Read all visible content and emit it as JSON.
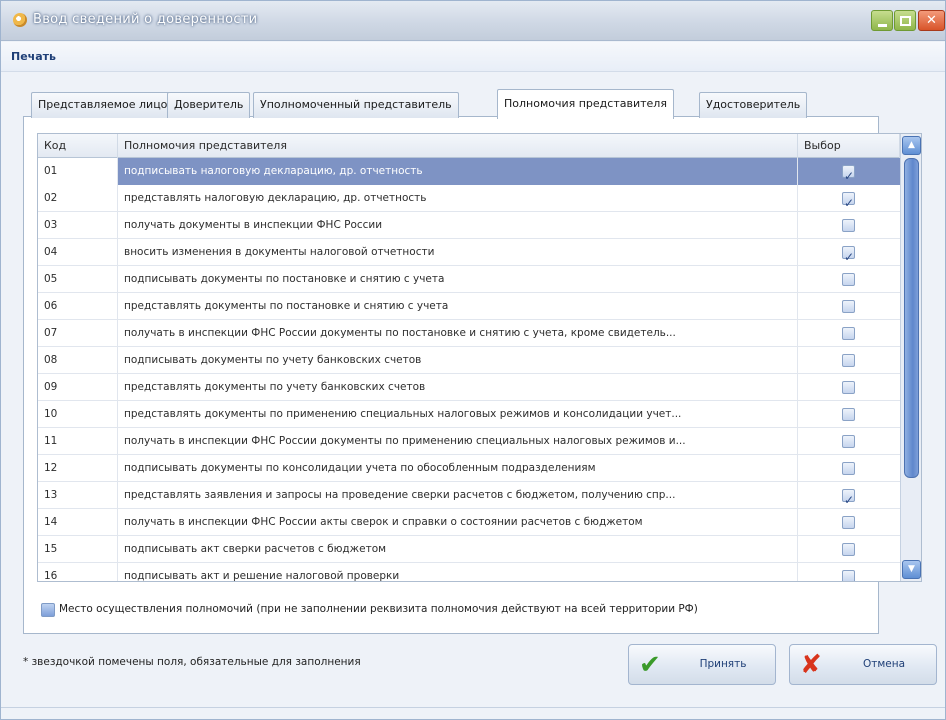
{
  "window": {
    "title": "Ввод сведений о доверенности",
    "controls": {
      "minimize_icon": "minimize-icon",
      "maximize_icon": "maximize-icon",
      "close_icon": "close-icon"
    }
  },
  "menu": {
    "print": "Печать"
  },
  "tabs": [
    {
      "label": "Представляемое лицо",
      "active": false
    },
    {
      "label": "Доверитель",
      "active": false
    },
    {
      "label": "Уполномоченный представитель",
      "active": false
    },
    {
      "label": "Полномочия представителя",
      "active": true
    },
    {
      "label": "Удостоверитель",
      "active": false
    }
  ],
  "grid": {
    "columns": {
      "code": "Код",
      "name": "Полномочия представителя",
      "select": "Выбор"
    },
    "rows": [
      {
        "code": "01",
        "name": "подписывать налоговую декларацию, др. отчетность",
        "checked": true,
        "selected": true
      },
      {
        "code": "02",
        "name": "представлять налоговую декларацию, др. отчетность",
        "checked": true
      },
      {
        "code": "03",
        "name": "получать документы в инспекции ФНС России",
        "checked": false
      },
      {
        "code": "04",
        "name": "вносить изменения в документы налоговой отчетности",
        "checked": true
      },
      {
        "code": "05",
        "name": "подписывать документы по постановке и снятию с учета",
        "checked": false
      },
      {
        "code": "06",
        "name": "представлять документы по постановке и снятию с учета",
        "checked": false
      },
      {
        "code": "07",
        "name": "получать в инспекции ФНС России документы по постановке и снятию с учета, кроме свидетель...",
        "checked": false
      },
      {
        "code": "08",
        "name": "подписывать документы по учету банковских счетов",
        "checked": false
      },
      {
        "code": "09",
        "name": "представлять документы по учету банковских счетов",
        "checked": false
      },
      {
        "code": "10",
        "name": "представлять документы по применению специальных налоговых режимов и консолидации учет...",
        "checked": false
      },
      {
        "code": "11",
        "name": "получать в инспекции ФНС России документы по применению специальных налоговых режимов и...",
        "checked": false
      },
      {
        "code": "12",
        "name": "подписывать документы по консолидации учета по обособленным подразделениям",
        "checked": false
      },
      {
        "code": "13",
        "name": "представлять заявления и запросы на проведение сверки расчетов с бюджетом, получению спр...",
        "checked": true
      },
      {
        "code": "14",
        "name": "получать в инспекции ФНС России акты сверок и справки о состоянии расчетов с бюджетом",
        "checked": false
      },
      {
        "code": "15",
        "name": "подписывать акт сверки расчетов с бюджетом",
        "checked": false
      },
      {
        "code": "16",
        "name": "подписывать акт и решение налоговой проверки",
        "checked": false
      }
    ]
  },
  "place": {
    "label": "Место осуществления полномочий   (при не заполнении реквизита полномочия действуют на всей территории РФ)",
    "checked": false
  },
  "note": "* звездочкой помечены поля, обязательные для заполнения",
  "buttons": {
    "ok": "Принять",
    "cancel": "Отмена"
  },
  "colors": {
    "selection": "#7e93c4",
    "accent": "#1f3f77",
    "ok_icon": "#3a9a2a",
    "cancel_icon": "#d8341c"
  }
}
